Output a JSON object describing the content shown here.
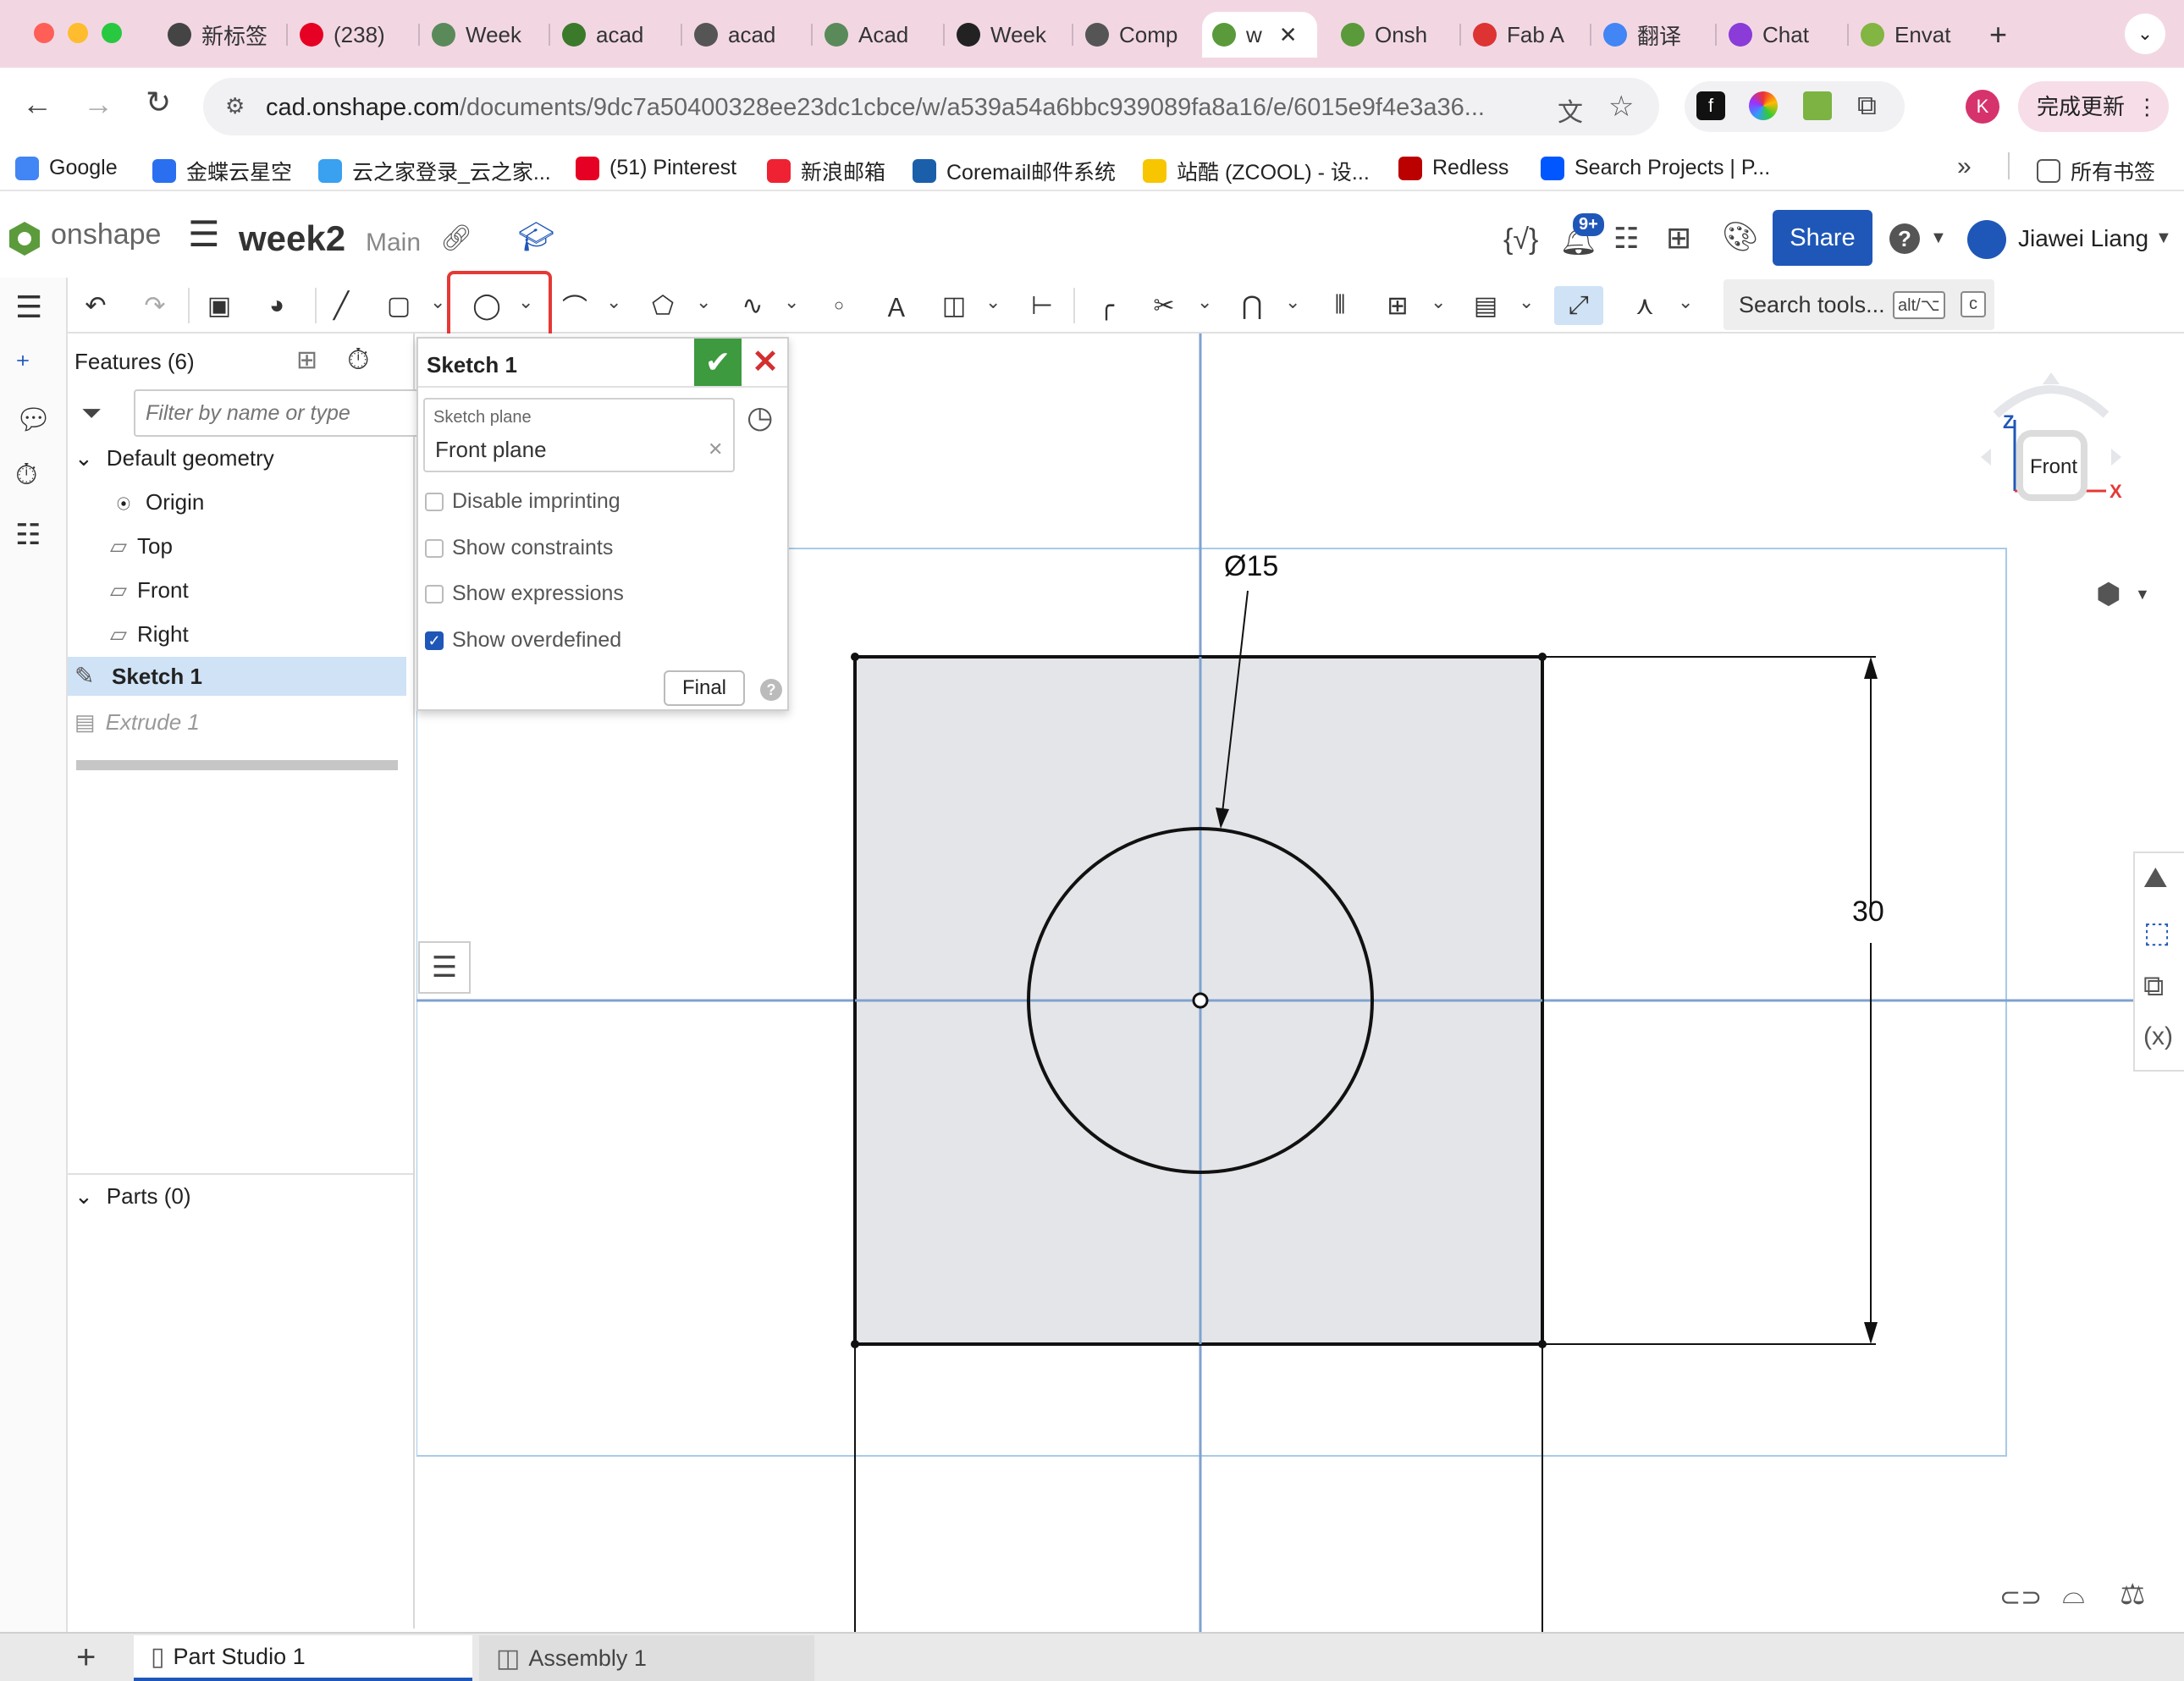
{
  "browser": {
    "tabs": [
      {
        "label": "新标签",
        "color": "#444"
      },
      {
        "label": "(238)",
        "color": "#e60023"
      },
      {
        "label": "Week",
        "color": "#5a8a5a"
      },
      {
        "label": "acad",
        "color": "#3a7a2a"
      },
      {
        "label": "acad",
        "color": "#555"
      },
      {
        "label": "Acad",
        "color": "#5a8a5a"
      },
      {
        "label": "Week",
        "color": "#222"
      },
      {
        "label": "Comp",
        "color": "#555"
      },
      {
        "label": "w",
        "color": "#5a9a3a"
      },
      {
        "label": "Onsh",
        "color": "#5a9a3a"
      },
      {
        "label": "Fab A",
        "color": "#d33"
      },
      {
        "label": "翻译",
        "color": "#4285f4"
      },
      {
        "label": "Chat",
        "color": "#8a3bd8"
      },
      {
        "label": "Envat",
        "color": "#82b541"
      }
    ],
    "new_tab": "+",
    "url_domain": "cad.onshape.com",
    "url_path": "/documents/9dc7a50400328ee23dc1cbce/w/a539a54a6bbc939089fa8a16/e/6015e9f4e3a36...",
    "profile_initial": "K",
    "update_button": "完成更新",
    "bookmarks": [
      {
        "label": "Google",
        "color": "#4285f4"
      },
      {
        "label": "金蝶云星空",
        "color": "#2a6ff0"
      },
      {
        "label": "云之家登录_云之家...",
        "color": "#3aa0f0"
      },
      {
        "label": "(51) Pinterest",
        "color": "#e60023"
      },
      {
        "label": "新浪邮箱",
        "color": "#e23"
      },
      {
        "label": "Coremail邮件系统",
        "color": "#1b5faa"
      },
      {
        "label": "站酷 (ZCOOL) - 设...",
        "color": "#f7c600"
      },
      {
        "label": "Redless",
        "color": "#b00"
      },
      {
        "label": "Search Projects | P...",
        "color": "#0057ff"
      }
    ],
    "bookmarks_more": "»",
    "all_bookmarks": "所有书签"
  },
  "onshape": {
    "brand": "onshape",
    "doc_name": "week2",
    "branch": "Main",
    "notifications_badge": "9+",
    "share_label": "Share",
    "help": "?",
    "user_name": "Jiawei Liang",
    "search_tools": "Search tools...",
    "search_shortcut_1": "alt/⌥",
    "search_shortcut_2": "c"
  },
  "features": {
    "title": "Features (6)",
    "filter_placeholder": "Filter by name or type",
    "default_geometry": "Default geometry",
    "items": [
      "Origin",
      "Top",
      "Front",
      "Right"
    ],
    "sketch": "Sketch 1",
    "extrude": "Extrude 1",
    "parts": "Parts (0)"
  },
  "sketch_dialog": {
    "title": "Sketch 1",
    "plane_label": "Sketch plane",
    "plane_value": "Front plane",
    "options": [
      {
        "label": "Disable imprinting",
        "checked": false
      },
      {
        "label": "Show constraints",
        "checked": false
      },
      {
        "label": "Show expressions",
        "checked": false
      },
      {
        "label": "Show overdefined",
        "checked": true
      }
    ],
    "final_button": "Final"
  },
  "viewport": {
    "view_cube_label": "Front",
    "axis_z": "Z",
    "axis_x": "X",
    "diameter_dim": "Ø15",
    "height_dim": "30"
  },
  "bottom_tabs": [
    {
      "label": "Part Studio 1",
      "active": true
    },
    {
      "label": "Assembly 1",
      "active": false
    }
  ]
}
